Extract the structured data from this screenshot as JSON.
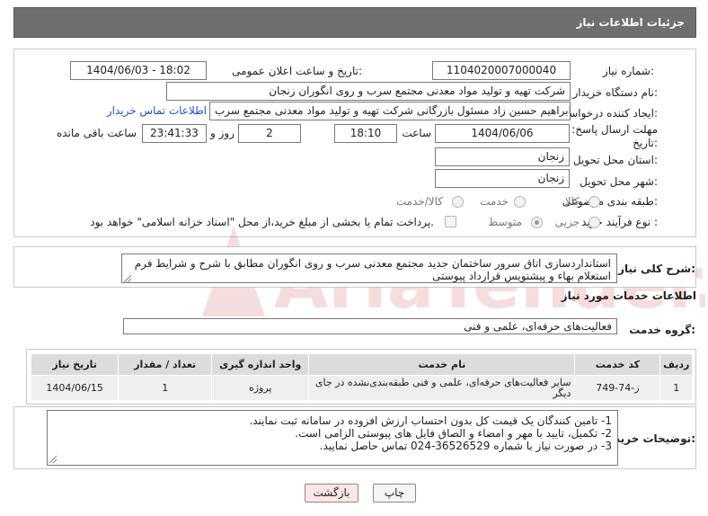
{
  "header": {
    "title": "جزئیات اطلاعات نیاز"
  },
  "form": {
    "need_number_label": "شماره نیاز:",
    "need_number": "1104020007000040",
    "announce_label": "تاریخ و ساعت اعلان عمومی:",
    "announce_value": "1404/06/03 - 18:02",
    "buyer_org_label": "نام دستگاه خریدار:",
    "buyer_org": "شرکت تهیه و تولید مواد معدنی مجتمع سرب و روی انگوران   زنجان",
    "creator_label": "ایجاد کننده درخواست:",
    "creator": "ابراهیم حسین زاد مسئول بازرگانی شرکت تهیه و تولید مواد معدنی مجتمع سرب",
    "contact_link": "اطلاعات تماس خریدار",
    "deadline_label_1": "مهلت ارسال پاسخ: تا",
    "deadline_label_2": "تاریخ:",
    "deadline_date": "1404/06/06",
    "time_label": "ساعت",
    "deadline_time": "18:10",
    "days_value": "2",
    "days_label": "روز و",
    "remaining_value": "23:41:33",
    "remaining_label": "ساعت باقی مانده",
    "province_label": "استان محل تحویل:",
    "province": "زنجان",
    "city_label": "شهر محل تحویل:",
    "city": "زنجان",
    "category_label": "طبقه بندی موضوعی:",
    "category_options": [
      "کالا",
      "خدمت",
      "کالا/خدمت"
    ],
    "category_selected": "خدمت",
    "process_label": "نوع فرآیند خرید :",
    "process_options": [
      "جزیی",
      "متوسط"
    ],
    "process_selected": "متوسط",
    "payment_note": "پرداخت تمام یا بخشی از مبلغ خرید،از محل \"اسناد خزانه اسلامی\" خواهد بود."
  },
  "description": {
    "label": "شرح کلی نیاز:",
    "text": "استانداردسازی اتاق سرور ساختمان جدید مجتمع معدنی سرب و روی انگوران مطابق با شرح و شرایط فرم استعلام بهاء و پیشنویس قرارداد پیوستی"
  },
  "services": {
    "section_title": "اطلاعات خدمات مورد نیاز",
    "group_label": "گروه خدمت:",
    "group_value": "فعالیت‌های حرفه‌ای، علمی و فنی",
    "columns": [
      "ردیف",
      "کد خدمت",
      "نام خدمت",
      "واحد اندازه گیری",
      "تعداد / مقدار",
      "تاریخ نیاز"
    ],
    "rows": [
      [
        "1",
        "ز-74-749",
        "سایر فعالیت‌های حرفه‌ای، علمی و فنی طبقه‌بندی‌نشده در جای دیگر",
        "پروژه",
        "1",
        "1404/06/15"
      ]
    ]
  },
  "buyer_notes": {
    "label": "توضیحات خریدار:",
    "lines": [
      "1- تامین کنندگان یک قیمت کل بدون احتساب ارزش افزوده در سامانه ثبت نمایند.",
      "2- تکمیل، تایید با مهر و امضاء و الصاق فایل های پیوستی الزامی است.",
      "3- در صورت نیاز با شماره 36526529-024 تماس حاصل نمایید."
    ]
  },
  "buttons": {
    "print": "چاپ",
    "back": "بازگشت"
  },
  "colors": {
    "header_bg": "#6f6f6f",
    "link": "#1f4fd1",
    "back_button_bg": "#ffe6e6",
    "table_header_bg": "#dcdcdc"
  },
  "watermark": {
    "text": "AriaTender.net"
  }
}
